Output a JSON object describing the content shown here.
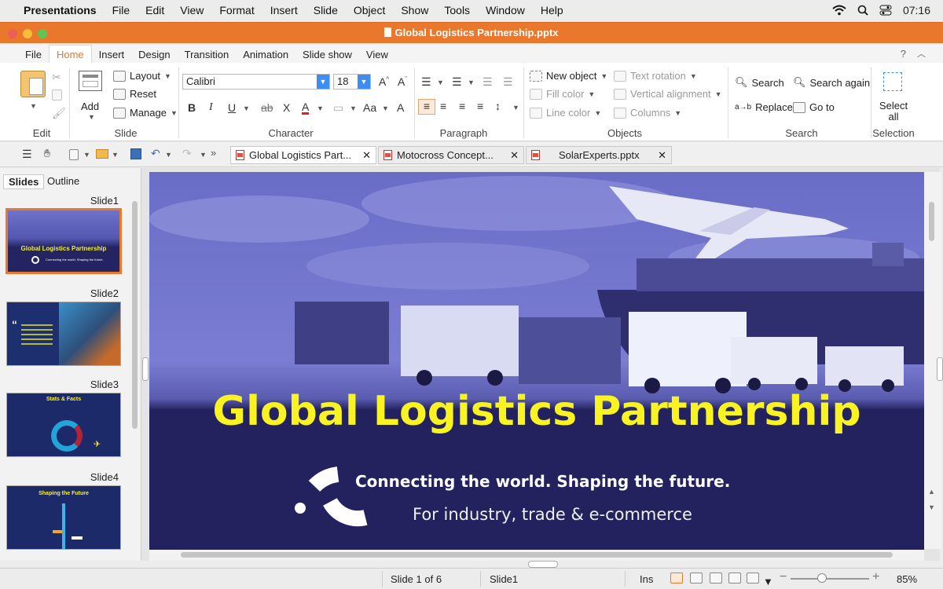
{
  "menubar": {
    "app": "Presentations",
    "items": [
      "File",
      "Edit",
      "View",
      "Format",
      "Insert",
      "Slide",
      "Object",
      "Show",
      "Tools",
      "Window",
      "Help"
    ],
    "time": "07:16"
  },
  "window": {
    "title": "Global Logistics Partnership.pptx"
  },
  "ribbon_tabs": [
    "File",
    "Home",
    "Insert",
    "Design",
    "Transition",
    "Animation",
    "Slide show",
    "View"
  ],
  "ribbon_help": "?",
  "ribbon": {
    "edit": {
      "label": "Edit"
    },
    "slide": {
      "add": "Add",
      "layout": "Layout",
      "reset": "Reset",
      "manage": "Manage",
      "label": "Slide"
    },
    "character": {
      "font": "Calibri",
      "size": "18",
      "label": "Character"
    },
    "paragraph": {
      "label": "Paragraph"
    },
    "objects": {
      "new_object": "New object",
      "fill_color": "Fill color",
      "line_color": "Line color",
      "text_rotation": "Text rotation",
      "vertical_alignment": "Vertical alignment",
      "columns": "Columns",
      "label": "Objects"
    },
    "search": {
      "search": "Search",
      "search_again": "Search again",
      "replace": "Replace",
      "goto": "Go to",
      "label": "Search"
    },
    "selection": {
      "select_all_1": "Select",
      "select_all_2": "all",
      "label": "Selection"
    }
  },
  "doc_tabs": [
    "Global Logistics Part...",
    "Motocross Concept...",
    "SolarExperts.pptx"
  ],
  "panel": {
    "tabs": [
      "Slides",
      "Outline"
    ],
    "slides": [
      "Slide1",
      "Slide2",
      "Slide3",
      "Slide4"
    ]
  },
  "thumbs": {
    "s1_title": "Global Logistics Partnership",
    "s1_sub": "Connecting the world. Shaping the future.",
    "s3_title": "Stats & Facts",
    "s4_title": "Shaping the Future"
  },
  "slide": {
    "title": "Global Logistics Partnership",
    "tagline": "Connecting the world. Shaping the future.",
    "subtag": "For industry, trade & e-commerce"
  },
  "status": {
    "position": "Slide 1 of 6",
    "slide_name": "Slide1",
    "mode": "Ins",
    "zoom": "85%"
  },
  "colors": {
    "accent": "#e9772c",
    "slide_bg": "#22215e",
    "title_yellow": "#f8f321"
  }
}
